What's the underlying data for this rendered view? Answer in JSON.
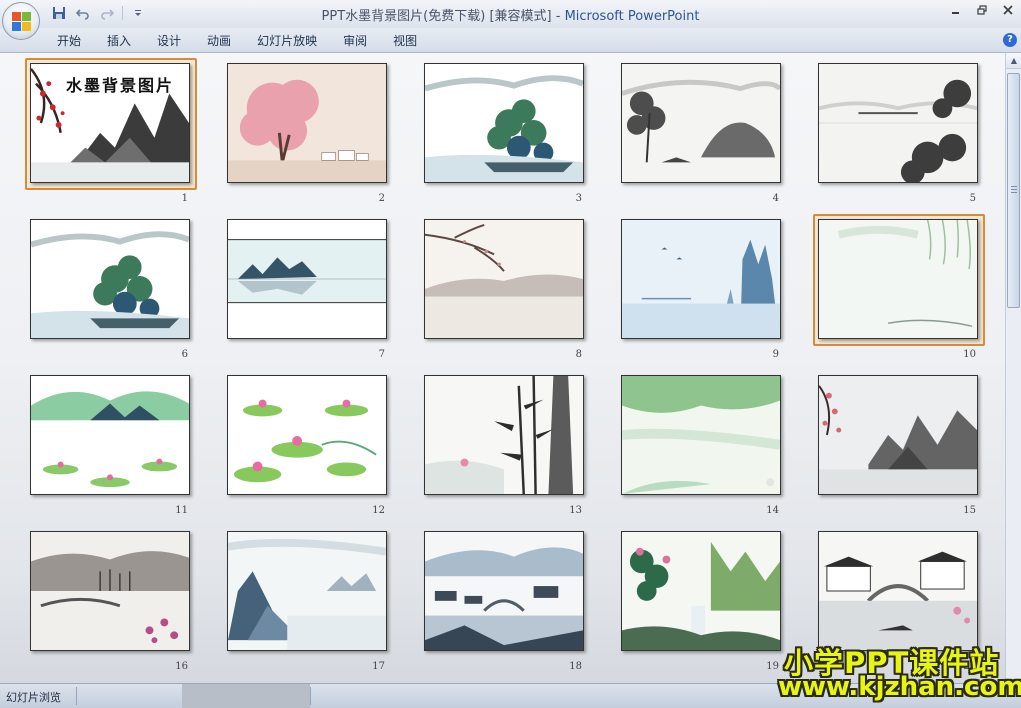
{
  "window": {
    "title_doc": "PPT水墨背景图片(免费下载) [兼容模式]",
    "title_sep": " - ",
    "title_app": "Microsoft PowerPoint"
  },
  "quick_access": {
    "save_icon": "save-icon",
    "undo_icon": "undo-icon",
    "redo_icon": "redo-icon",
    "customize_icon": "customize-qat-icon"
  },
  "ribbon": {
    "tabs": [
      "开始",
      "插入",
      "设计",
      "动画",
      "幻灯片放映",
      "审阅",
      "视图"
    ],
    "help_label": "?"
  },
  "slides": [
    {
      "number": "1",
      "title": "水墨背景图片",
      "selected": true,
      "theme": "plum-mountain"
    },
    {
      "number": "2",
      "selected": false,
      "theme": "pink-tree"
    },
    {
      "number": "3",
      "selected": false,
      "theme": "green-pine"
    },
    {
      "number": "4",
      "selected": false,
      "theme": "ink-rocks"
    },
    {
      "number": "5",
      "selected": false,
      "theme": "ink-bridge"
    },
    {
      "number": "6",
      "selected": false,
      "theme": "green-pine"
    },
    {
      "number": "7",
      "selected": false,
      "theme": "lake-band"
    },
    {
      "number": "8",
      "selected": false,
      "theme": "branch-lake"
    },
    {
      "number": "9",
      "selected": false,
      "theme": "blue-cliffs"
    },
    {
      "number": "10",
      "selected": true,
      "theme": "pale-willow"
    },
    {
      "number": "11",
      "selected": false,
      "theme": "green-lotus"
    },
    {
      "number": "12",
      "selected": false,
      "theme": "lotus-pond"
    },
    {
      "number": "13",
      "selected": false,
      "theme": "bamboo"
    },
    {
      "number": "14",
      "selected": false,
      "theme": "green-wash"
    },
    {
      "number": "15",
      "selected": false,
      "theme": "plum-mountain-2"
    },
    {
      "number": "16",
      "selected": false,
      "theme": "winter-bridge"
    },
    {
      "number": "17",
      "selected": false,
      "theme": "blue-mountain"
    },
    {
      "number": "18",
      "selected": false,
      "theme": "village-bridge"
    },
    {
      "number": "19",
      "selected": false,
      "theme": "waterfall"
    },
    {
      "number": "20",
      "selected": false,
      "theme": "water-town"
    }
  ],
  "statusbar": {
    "view_label": "幻灯片浏览"
  },
  "watermark": {
    "line1": "小学PPT课件站",
    "line2": "www.kjzhan.com"
  },
  "colors": {
    "selection": "#d58c3a",
    "accent": "#2f5496"
  }
}
